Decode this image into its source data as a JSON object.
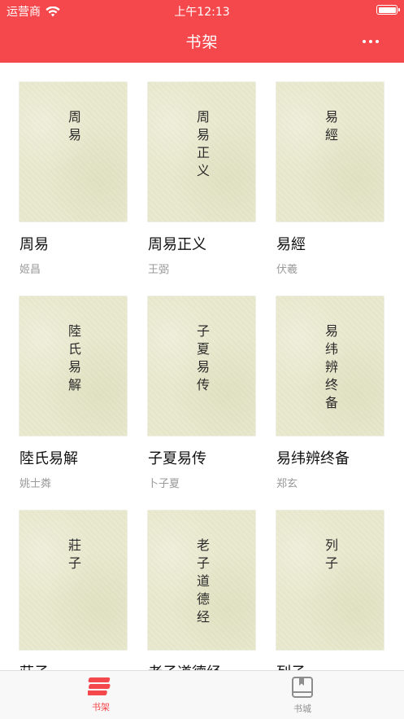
{
  "status": {
    "carrier": "运营商",
    "time": "上午12:13"
  },
  "nav": {
    "title": "书架"
  },
  "books": [
    {
      "title": "周易",
      "author": "姬昌",
      "cover_title": "周易"
    },
    {
      "title": "周易正义",
      "author": "王弼",
      "cover_title": "周易正义"
    },
    {
      "title": "易經",
      "author": "伏羲",
      "cover_title": "易經"
    },
    {
      "title": "陸氏易解",
      "author": "姚士粦",
      "cover_title": "陸氏易解"
    },
    {
      "title": "子夏易传",
      "author": "卜子夏",
      "cover_title": "子夏易传"
    },
    {
      "title": "易纬辨终备",
      "author": "郑玄",
      "cover_title": "易纬辨终备"
    },
    {
      "title": "莊子",
      "author": "",
      "cover_title": "莊子"
    },
    {
      "title": "老子道德经",
      "author": "",
      "cover_title": "老子道德经"
    },
    {
      "title": "列子",
      "author": "",
      "cover_title": "列子"
    }
  ],
  "tabs": [
    {
      "label": "书架",
      "icon": "bookshelf-icon",
      "active": true
    },
    {
      "label": "书城",
      "icon": "book-icon",
      "active": false
    }
  ],
  "colors": {
    "accent": "#f4484c",
    "cover": "#e9e9cf",
    "inactive": "#8e8e8e"
  }
}
